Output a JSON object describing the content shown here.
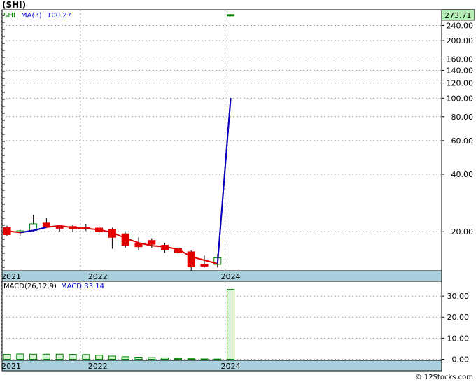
{
  "title": "(SHI)",
  "credit": "© 12Stocks.com",
  "colors": {
    "up": "#008000",
    "down": "#e00000",
    "ma": "#0000cc",
    "ma_low": "#e00000",
    "grid": "#999999",
    "axis_band": "#a9d0dc",
    "last_price_bg": "#b6f0b6",
    "macd_bar_fill": "#d8f5d8",
    "macd_bar_edge": "#008000",
    "legend_blue": "#0000cc",
    "legend_green": "#008000"
  },
  "chart_data": [
    {
      "type": "candlestick",
      "legend": {
        "ticker": "SHI",
        "ma_label": "MA(3)",
        "ma_value": "100.27"
      },
      "last_price_label": "273.71",
      "y_scale": "log",
      "ylim": [
        12.5,
        290
      ],
      "y_ticks": [
        "20.00",
        "40.00",
        "60.00",
        "80.00",
        "100.00",
        "120.00",
        "140.00",
        "160.00",
        "200.00",
        "240.00"
      ],
      "y_tick_values": [
        20,
        40,
        60,
        80,
        100,
        120,
        140,
        160,
        200,
        240
      ],
      "x_labels": [
        "2021",
        "2022",
        "2024"
      ],
      "candles": [
        {
          "o": 21.0,
          "h": 21.5,
          "l": 19.0,
          "c": 19.3
        },
        {
          "o": 19.8,
          "h": 20.5,
          "l": 19.0,
          "c": 20.2
        },
        {
          "o": 20.3,
          "h": 24.5,
          "l": 20.0,
          "c": 22.0
        },
        {
          "o": 22.2,
          "h": 23.5,
          "l": 21.0,
          "c": 21.3
        },
        {
          "o": 21.2,
          "h": 21.6,
          "l": 20.0,
          "c": 21.0
        },
        {
          "o": 21.3,
          "h": 21.8,
          "l": 20.0,
          "c": 20.7
        },
        {
          "o": 21.0,
          "h": 22.0,
          "l": 20.2,
          "c": 20.8
        },
        {
          "o": 20.9,
          "h": 21.5,
          "l": 19.6,
          "c": 20.0
        },
        {
          "o": 20.5,
          "h": 21.0,
          "l": 16.3,
          "c": 18.7
        },
        {
          "o": 19.5,
          "h": 19.8,
          "l": 16.5,
          "c": 17.0
        },
        {
          "o": 17.3,
          "h": 18.7,
          "l": 16.0,
          "c": 16.7
        },
        {
          "o": 18.0,
          "h": 18.5,
          "l": 16.5,
          "c": 17.2
        },
        {
          "o": 17.0,
          "h": 17.5,
          "l": 15.5,
          "c": 16.1
        },
        {
          "o": 16.3,
          "h": 16.8,
          "l": 15.2,
          "c": 15.5
        },
        {
          "o": 15.7,
          "h": 16.0,
          "l": 12.5,
          "c": 13.1
        },
        {
          "o": 13.5,
          "h": 15.0,
          "l": 13.0,
          "c": 13.2
        },
        {
          "o": 13.5,
          "h": 15.3,
          "l": 13.0,
          "c": 14.6
        },
        {
          "o": 273.71,
          "h": 275.0,
          "l": 271.0,
          "c": 273.71
        }
      ],
      "ma": [
        20.2,
        19.8,
        20.3,
        21.1,
        21.5,
        21.0,
        20.8,
        20.5,
        19.8,
        18.5,
        17.5,
        16.9,
        16.7,
        16.2,
        14.8,
        14.2,
        13.6,
        100.27
      ]
    },
    {
      "type": "bar",
      "legend": {
        "label": "MACD(26,12,9)",
        "value_label": "MACD:33.14"
      },
      "ylim": [
        -0.5,
        37
      ],
      "y_ticks": [
        "0.00",
        "10.00",
        "20.00",
        "30.00"
      ],
      "y_tick_values": [
        0,
        10,
        20,
        30
      ],
      "x_labels": [
        "2021",
        "2022",
        "2024"
      ],
      "values": [
        2.3,
        2.5,
        2.4,
        2.4,
        2.4,
        2.3,
        2.2,
        1.9,
        1.5,
        1.2,
        1.0,
        0.8,
        0.6,
        0.4,
        0.25,
        0.15,
        0.1,
        33.14
      ]
    }
  ]
}
